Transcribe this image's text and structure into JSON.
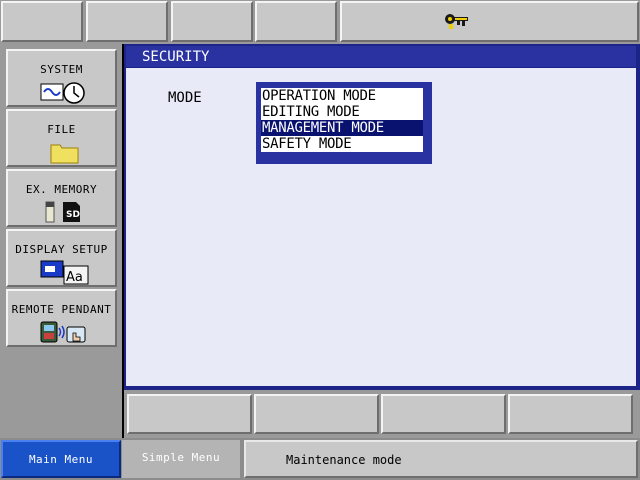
{
  "window": {
    "title": "SECURITY"
  },
  "top_bar": {
    "status_icon": "security-key-icon"
  },
  "left_menu": [
    {
      "label": "SYSTEM",
      "icon": "system-clock-icon"
    },
    {
      "label": "FILE",
      "icon": "folder-icon"
    },
    {
      "label": "EX. MEMORY",
      "icon": "sd-card-icon"
    },
    {
      "label": "DISPLAY SETUP",
      "icon": "display-font-icon"
    },
    {
      "label": "REMOTE PENDANT",
      "icon": "remote-pendant-icon"
    }
  ],
  "security": {
    "mode_label": "MODE",
    "options": [
      "OPERATION MODE",
      "EDITING MODE",
      "MANAGEMENT MODE",
      "SAFETY MODE"
    ],
    "selected": "MANAGEMENT MODE"
  },
  "bottom_bar": {
    "main_menu": "Main Menu",
    "simple_menu": "Simple Menu",
    "status": "Maintenance mode"
  },
  "colors": {
    "title_blue": "#2a31a0",
    "selection": "#0a1270",
    "main_menu_blue": "#1a52c8"
  }
}
